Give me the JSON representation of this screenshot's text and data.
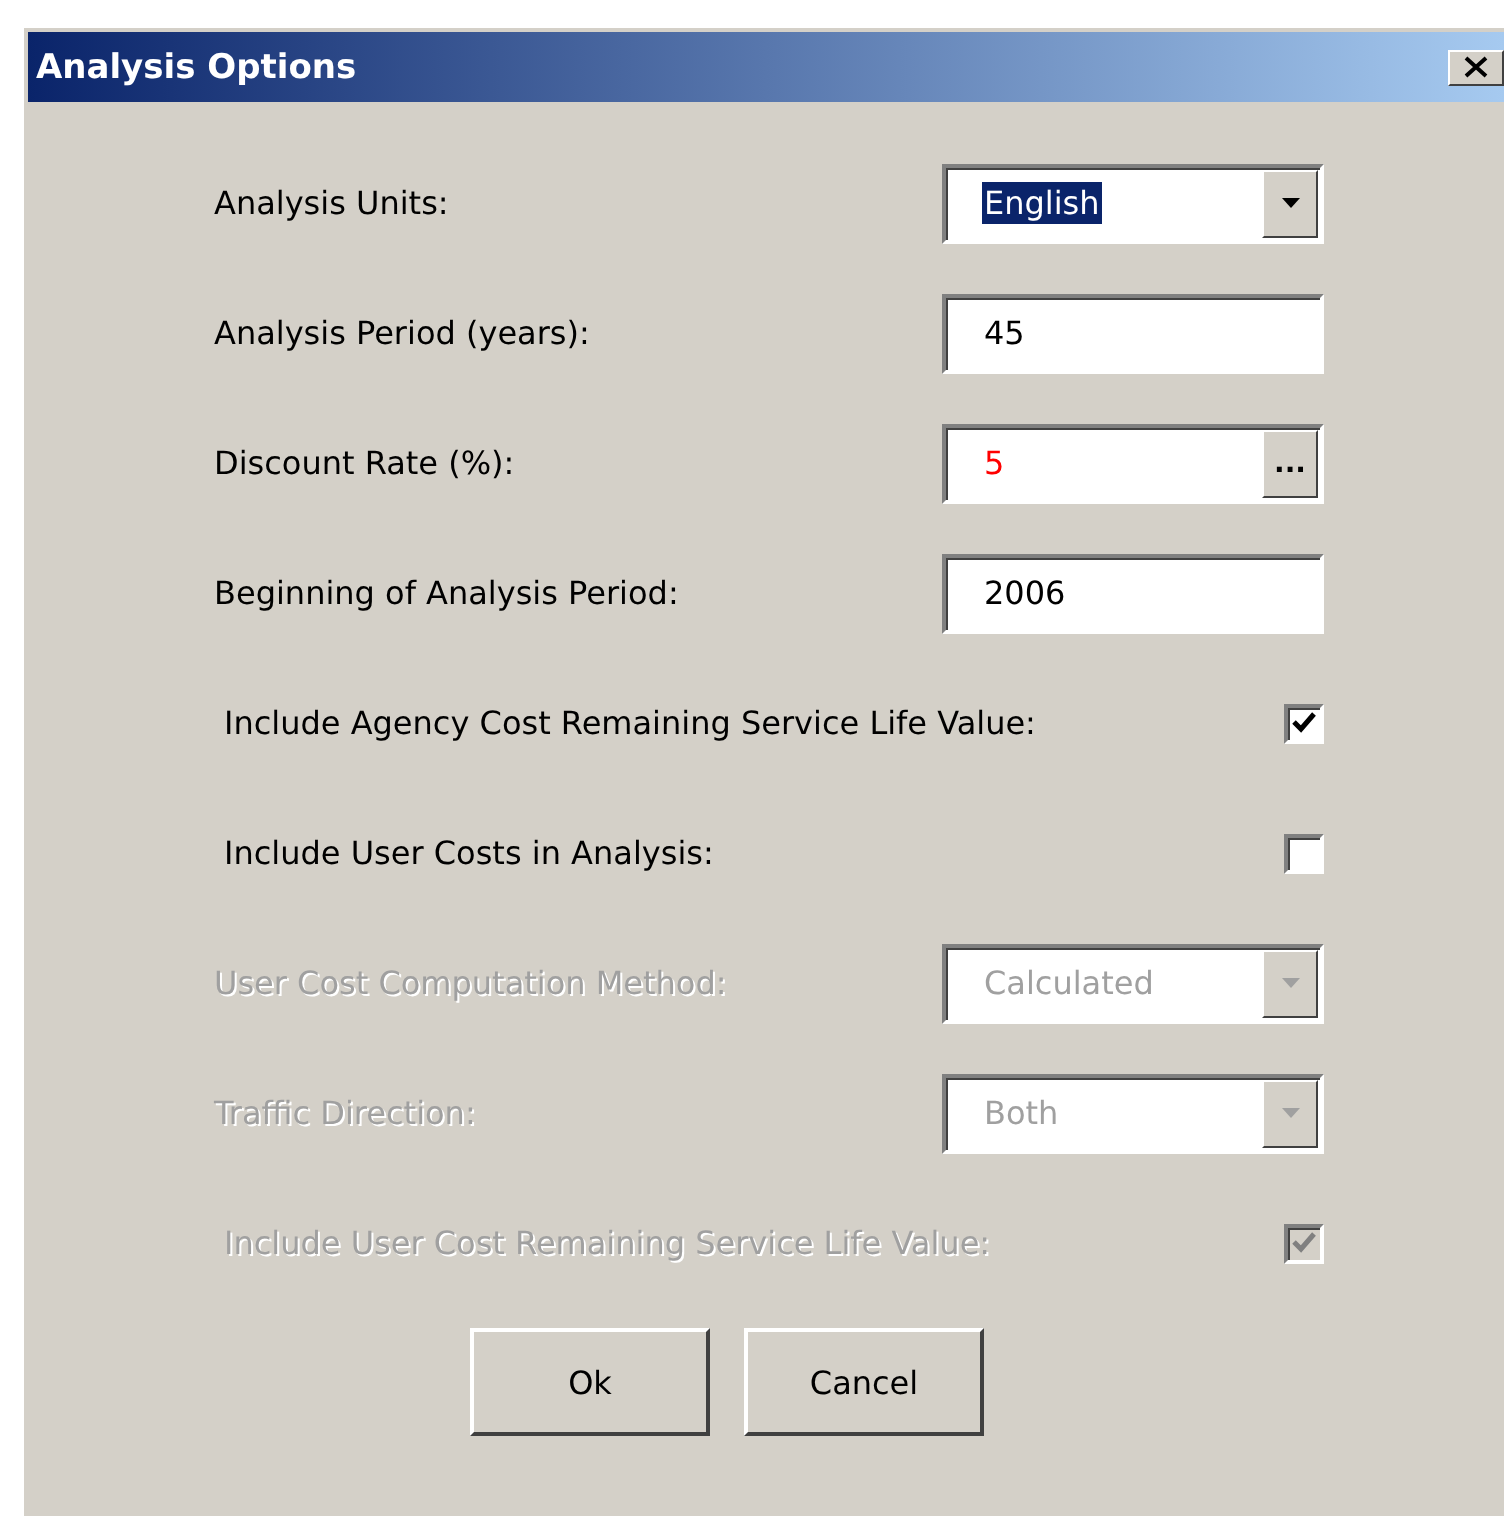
{
  "window": {
    "title": "Analysis Options"
  },
  "rows": [
    {
      "kind": "dropdown",
      "label": "Analysis Units:",
      "value": "English",
      "highlighted": true,
      "disabled": false
    },
    {
      "kind": "text",
      "label": "Analysis Period (years):",
      "value": "45",
      "disabled": false
    },
    {
      "kind": "browse",
      "label": "Discount Rate (%):",
      "value": "5",
      "color": "#ff0000",
      "button": "...",
      "disabled": false
    },
    {
      "kind": "text",
      "label": "Beginning of Analysis Period:",
      "value": "2006",
      "disabled": false
    },
    {
      "kind": "checkbox",
      "label": "Include Agency Cost Remaining Service Life Value:",
      "checked": true,
      "disabled": false
    },
    {
      "kind": "checkbox",
      "label": "Include User Costs in Analysis:",
      "checked": false,
      "disabled": false
    },
    {
      "kind": "dropdown",
      "label": "User Cost Computation Method:",
      "value": "Calculated",
      "highlighted": false,
      "disabled": true
    },
    {
      "kind": "dropdown",
      "label": "Traffic Direction:",
      "value": "Both",
      "highlighted": false,
      "disabled": true
    },
    {
      "kind": "checkbox",
      "label": "Include User Cost Remaining Service Life Value:",
      "checked": true,
      "disabled": true
    }
  ],
  "buttons": [
    "Ok",
    "Cancel"
  ]
}
